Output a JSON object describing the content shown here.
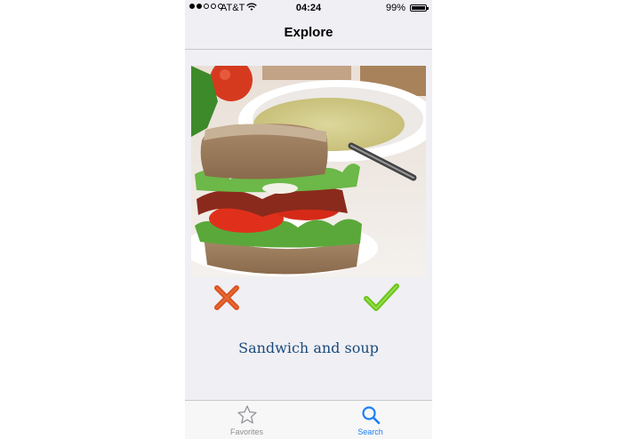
{
  "status_bar": {
    "carrier": "AT&T",
    "time": "04:24",
    "battery_percent": "99%",
    "battery_level": 0.99,
    "signal_bars_filled": 2,
    "signal_bars_total": 5
  },
  "nav": {
    "title": "Explore"
  },
  "card": {
    "photo_icon": "food-photo",
    "caption": "Sandwich and soup",
    "reject_icon": "cross-icon",
    "accept_icon": "checkmark-icon",
    "reject_color": "#d9521f",
    "accept_color": "#6cc417"
  },
  "tabs": [
    {
      "label": "Favorites",
      "icon": "star-icon",
      "selected": false
    },
    {
      "label": "Search",
      "icon": "search-icon",
      "selected": true
    }
  ],
  "colors": {
    "accent": "#1b7ef7",
    "caption": "#1a4a7a"
  }
}
